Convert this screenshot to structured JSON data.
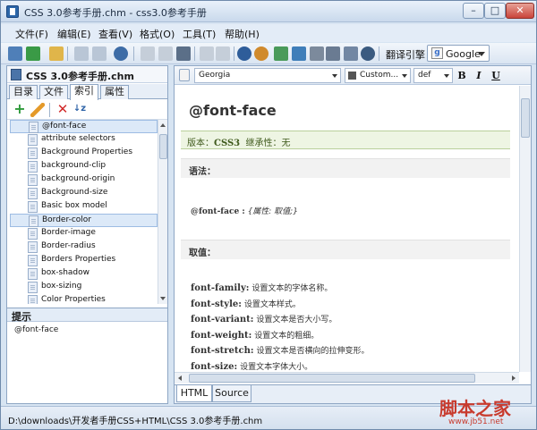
{
  "window": {
    "title": "CSS 3.0参考手册.chm - css3.0参考手册",
    "min": "–",
    "max": "□",
    "close": "✕"
  },
  "menu": [
    "文件(F)",
    "编辑(E)",
    "查看(V)",
    "格式(O)",
    "工具(T)",
    "帮助(H)"
  ],
  "toolbar": {
    "translate_label": "翻译引擎",
    "engine": "Google"
  },
  "left": {
    "doc_title": "CSS 3.0参考手册.chm",
    "tabs": [
      "目录",
      "文件",
      "索引",
      "属性"
    ],
    "active_tab": 2,
    "index_items": [
      "@font-face",
      "attribute selectors",
      "Background Properties",
      "background-clip",
      "background-origin",
      "Background-size",
      "Basic box model",
      "Border-color",
      "Border-image",
      "Border-radius",
      "Borders Properties",
      "box-shadow",
      "box-sizing",
      "Color Properties"
    ],
    "selected_items": [
      0,
      7
    ],
    "hint_title": "提示",
    "hint_value": "@font-face"
  },
  "editor": {
    "font": "Georgia",
    "color_label": "Custom...",
    "size": "def",
    "bold": "B",
    "italic": "I",
    "underline": "U"
  },
  "content": {
    "heading": "@font-face",
    "version_label": "版本：",
    "version_value": "CSS3",
    "inherit_label": "继承性：",
    "inherit_value": "无",
    "syntax_head": "语法：",
    "syntax_name": "@font-face :",
    "syntax_value": "{属性: 取值;}",
    "values_head": "取值：",
    "props": [
      {
        "name": "font-family:",
        "desc": "设置文本的字体名称。"
      },
      {
        "name": "font-style:",
        "desc": "设置文本样式。"
      },
      {
        "name": "font-variant:",
        "desc": "设置文本是否大小写。"
      },
      {
        "name": "font-weight:",
        "desc": "设置文本的粗细。"
      },
      {
        "name": "font-stretch:",
        "desc": "设置文本是否横向的拉伸变形。"
      },
      {
        "name": "font-size:",
        "desc": "设置文本字体大小。"
      }
    ]
  },
  "bottom_tabs": [
    "HTML",
    "Source"
  ],
  "status": "D:\\downloads\\开发者手册CSS+HTML\\CSS 3.0参考手册.chm",
  "watermark": {
    "text": "脚本之家",
    "url": "www.jb51.net"
  },
  "colors": {
    "accent": "#2c66a8",
    "selection": "#dce9f8",
    "version_bg": "#eef5e3"
  }
}
